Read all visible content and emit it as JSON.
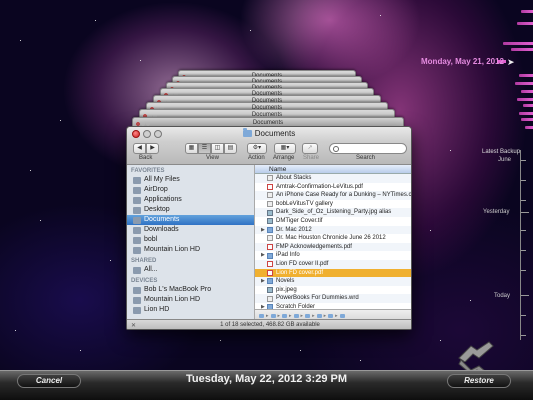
{
  "finder": {
    "window_title": "Documents",
    "toolbar": {
      "back": "Back",
      "view": "View",
      "action": "Action",
      "arrange": "Arrange",
      "share": "Share",
      "search": "Search"
    },
    "sidebar": {
      "favorites_header": "FAVORITES",
      "favorites": [
        {
          "label": "All My Files",
          "icon": "all-files-icon"
        },
        {
          "label": "AirDrop",
          "icon": "airdrop-icon"
        },
        {
          "label": "Applications",
          "icon": "applications-icon"
        },
        {
          "label": "Desktop",
          "icon": "desktop-icon"
        },
        {
          "label": "Documents",
          "icon": "documents-icon",
          "selected": true
        },
        {
          "label": "Downloads",
          "icon": "downloads-icon"
        },
        {
          "label": "bobl",
          "icon": "home-icon"
        },
        {
          "label": "Mountain Lion HD",
          "icon": "disk-icon"
        }
      ],
      "shared_header": "SHARED",
      "shared": [
        {
          "label": "All...",
          "icon": "network-icon"
        }
      ],
      "devices_header": "DEVICES",
      "devices": [
        {
          "label": "Bob L's MacBook Pro",
          "icon": "laptop-icon"
        },
        {
          "label": "Mountain Lion HD",
          "icon": "disk-icon"
        },
        {
          "label": "Lion HD",
          "icon": "disk-icon"
        }
      ]
    },
    "list": {
      "column_name": "Name",
      "rows": [
        {
          "name": "About Stacks",
          "kind": "file",
          "folder": false
        },
        {
          "name": "Amtrak-Confirmation-LeVitus.pdf",
          "kind": "pdf",
          "folder": false
        },
        {
          "name": "An iPhone Case Ready for a Dunking – NYTimes.com",
          "kind": "file",
          "folder": false
        },
        {
          "name": "bobLeVitusTV gallery",
          "kind": "file",
          "folder": false
        },
        {
          "name": "Dark_Side_of_Oz_Listening_Party.jpg alias",
          "kind": "img",
          "folder": false
        },
        {
          "name": "DMTiger Cover.tif",
          "kind": "img",
          "folder": false
        },
        {
          "name": "Dr. Mac 2012",
          "kind": "folder",
          "folder": true
        },
        {
          "name": "Dr. Mac Houston Chronicle June 26 2012",
          "kind": "file",
          "folder": false
        },
        {
          "name": "FMP Acknowledgements.pdf",
          "kind": "pdf",
          "folder": false
        },
        {
          "name": "iPad Info",
          "kind": "folder",
          "folder": true
        },
        {
          "name": "Lion FD cover II.pdf",
          "kind": "pdf",
          "folder": false
        },
        {
          "name": "Lion FD cover.pdf",
          "kind": "pdf",
          "folder": false,
          "selected": true
        },
        {
          "name": "Novels",
          "kind": "folder",
          "folder": true
        },
        {
          "name": "pix.jpeg",
          "kind": "img",
          "folder": false
        },
        {
          "name": "PowerBooks For Dummies.wrd",
          "kind": "file",
          "folder": false
        },
        {
          "name": "Scratch Folder",
          "kind": "folder",
          "folder": true
        }
      ]
    },
    "status": "1 of 18 selected, 468.82 GB available"
  },
  "stack": {
    "window_title": "Documents"
  },
  "timeline": {
    "current_date": "Monday, May 21, 2012",
    "latest_backup": "Latest Backup",
    "june": "June",
    "yesterday": "Yesterday",
    "today": "Today",
    "accent": "#e05fcf"
  },
  "bottom_bar": {
    "cancel": "Cancel",
    "date": "Tuesday, May 22, 2012 3:29 PM",
    "restore": "Restore"
  }
}
